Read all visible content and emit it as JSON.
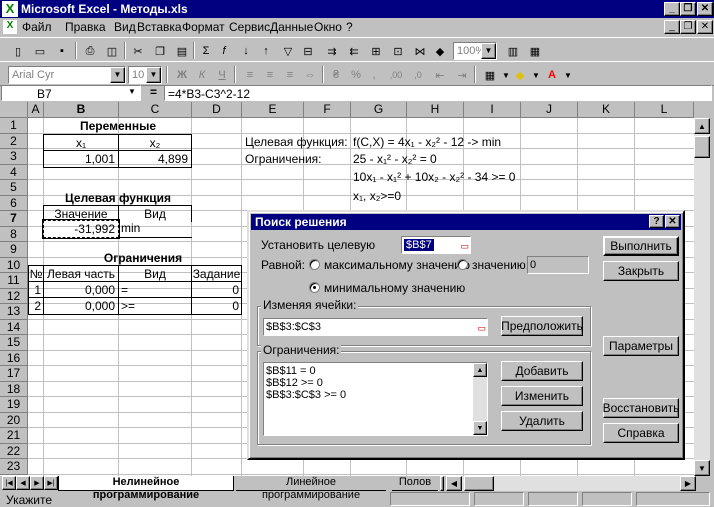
{
  "window": {
    "title": "Microsoft Excel - Методы.xls"
  },
  "menu": [
    "Файл",
    "Правка",
    "Вид",
    "Вставка",
    "Формат",
    "Сервис",
    "Данные",
    "Окно",
    "?"
  ],
  "toolbar": {
    "zoom": "100%",
    "font": "Arial Cyr",
    "size": "10"
  },
  "formula_bar": {
    "name_box": "B7",
    "eq": "=",
    "formula": "=4*B3-C3^2-12"
  },
  "columns": [
    "A",
    "B",
    "C",
    "D",
    "E",
    "F",
    "G",
    "H",
    "I",
    "J",
    "K",
    "L"
  ],
  "rows": [
    "1",
    "2",
    "3",
    "4",
    "5",
    "6",
    "7",
    "8",
    "9",
    "10",
    "11",
    "12",
    "13",
    "14",
    "15",
    "16",
    "17",
    "18",
    "19",
    "20",
    "21",
    "22",
    "23"
  ],
  "sheet": {
    "variables_title": "Переменные",
    "x1_label": "x₁",
    "x2_label": "x₂",
    "x1_value": "1,001",
    "x2_value": "4,899",
    "objective_title": "Целевая функция",
    "value_label": "Значение",
    "kind_label": "Вид",
    "objective_value": "-31,992",
    "objective_kind": "min",
    "constraints_title": "Ограничения",
    "constraints_headers": [
      "№",
      "Левая часть",
      "Вид",
      "Задание"
    ],
    "constraints_rows": [
      {
        "n": "1",
        "left": "0,000",
        "kind": "=",
        "target": "0"
      },
      {
        "n": "2",
        "left": "0,000",
        "kind": ">=",
        "target": "0"
      }
    ],
    "e2": "Целевая функция:",
    "g2": "f(C,X) = 4x₁ - x₂² - 12 -> min",
    "e3": "Ограничения:",
    "g3": "25 - x₁² - x₂² = 0",
    "g4": "10x₁ - x₁² + 10x₂ - x₂² - 34 >= 0",
    "g5": "x₁, x₂>=0"
  },
  "sheet_tabs": [
    "Нелинейное программирование",
    "Линейное программирование",
    "Полов"
  ],
  "status": "Укажите",
  "dialog": {
    "title": "Поиск решения",
    "help_btn": "?",
    "close_btn": "✕",
    "target_label": "Установить целевую",
    "target_value": "$B$7",
    "equal_label": "Равной:",
    "radio_max": "максимальному значению",
    "radio_value": "значению:",
    "value_field": "0",
    "radio_min": "минимальному значению",
    "changing_label": "Изменяя ячейки:",
    "changing_value": "$B$3:$C$3",
    "guess_btn": "Предположить",
    "constraints_label": "Ограничения:",
    "constraints": [
      "$B$11 = 0",
      "$B$12 >= 0",
      "$B$3:$C$3 >= 0"
    ],
    "add_btn": "Добавить",
    "change_btn": "Изменить",
    "delete_btn": "Удалить",
    "run_btn": "Выполнить",
    "close_btn_label": "Закрыть",
    "params_btn": "Параметры",
    "restore_btn": "Восстановить",
    "help_label": "Справка"
  },
  "colors": {
    "title_bg": "#000080",
    "face": "#c0c0c0"
  }
}
